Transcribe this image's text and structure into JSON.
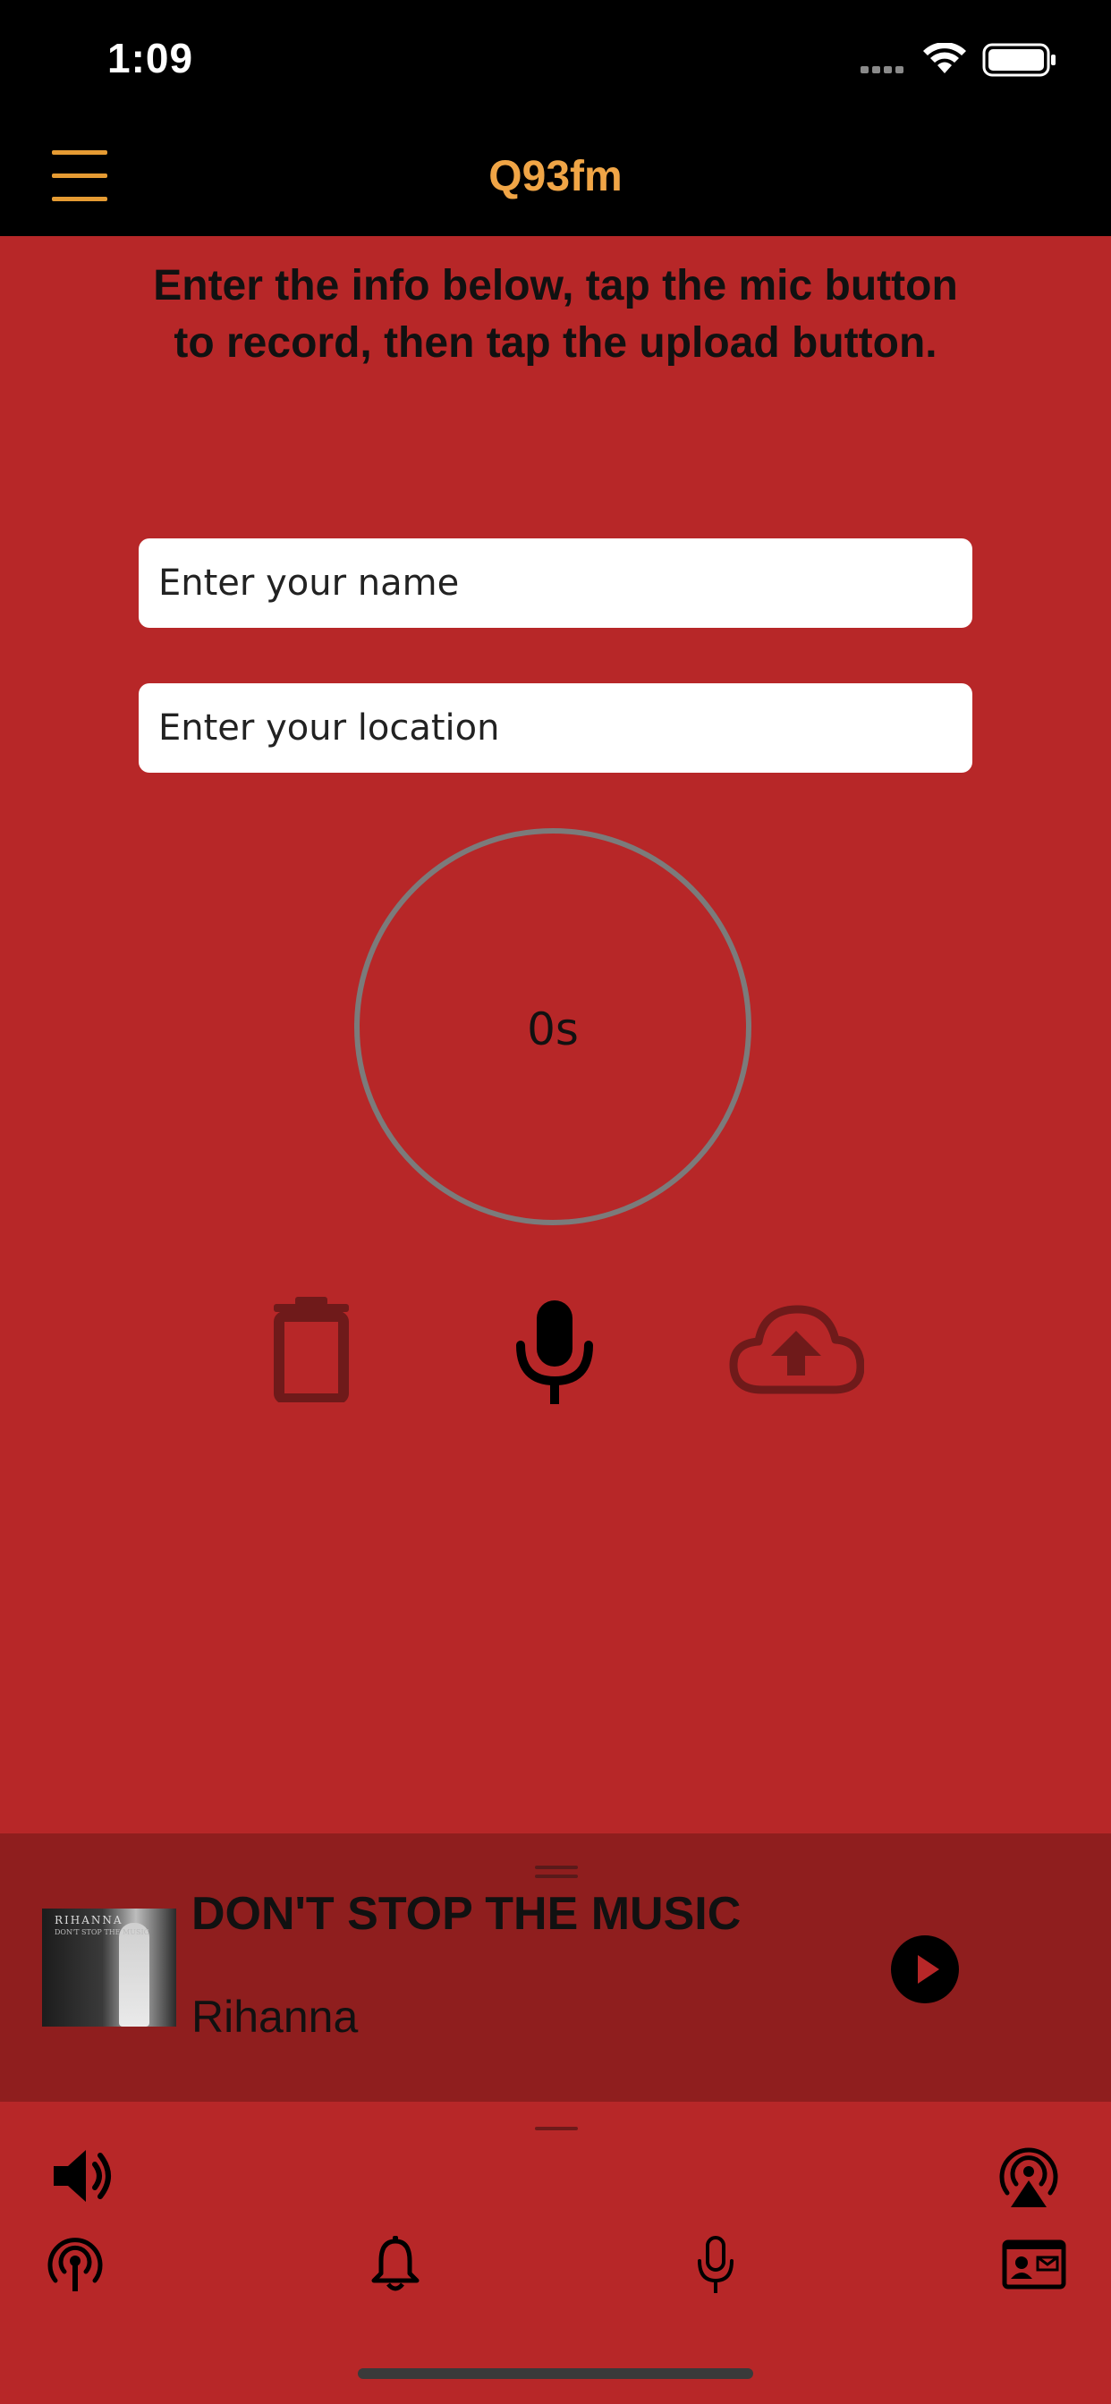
{
  "status_bar": {
    "time": "1:09",
    "icons": [
      "signal-dots-icon",
      "wifi-icon",
      "battery-icon"
    ]
  },
  "nav": {
    "title": "Q93fm",
    "menu_icon": "hamburger-menu-icon"
  },
  "form": {
    "instructions": "Enter the info below, tap the mic button to record, then tap the upload button.",
    "name_placeholder": "Enter your name",
    "location_placeholder": "Enter your location"
  },
  "recorder": {
    "timer": "0s",
    "controls": [
      "trash-icon",
      "microphone-icon",
      "cloud-upload-icon"
    ]
  },
  "now_playing": {
    "title": "DON'T STOP THE MUSIC",
    "artist": "Rihanna",
    "album_art_text": "RIHANNA",
    "album_art_subtext": "DON'T STOP THE MUSIC"
  },
  "toolbar": {
    "top_row": [
      "volume-icon",
      "airplay-icon"
    ],
    "bottom_row": [
      "podcast-icon",
      "bell-icon",
      "microphone-icon",
      "contact-card-icon"
    ]
  },
  "colors": {
    "background": "#b72728",
    "mini_player": "#8f1e1e",
    "accent": "#f0a546",
    "bars": "#000000"
  }
}
